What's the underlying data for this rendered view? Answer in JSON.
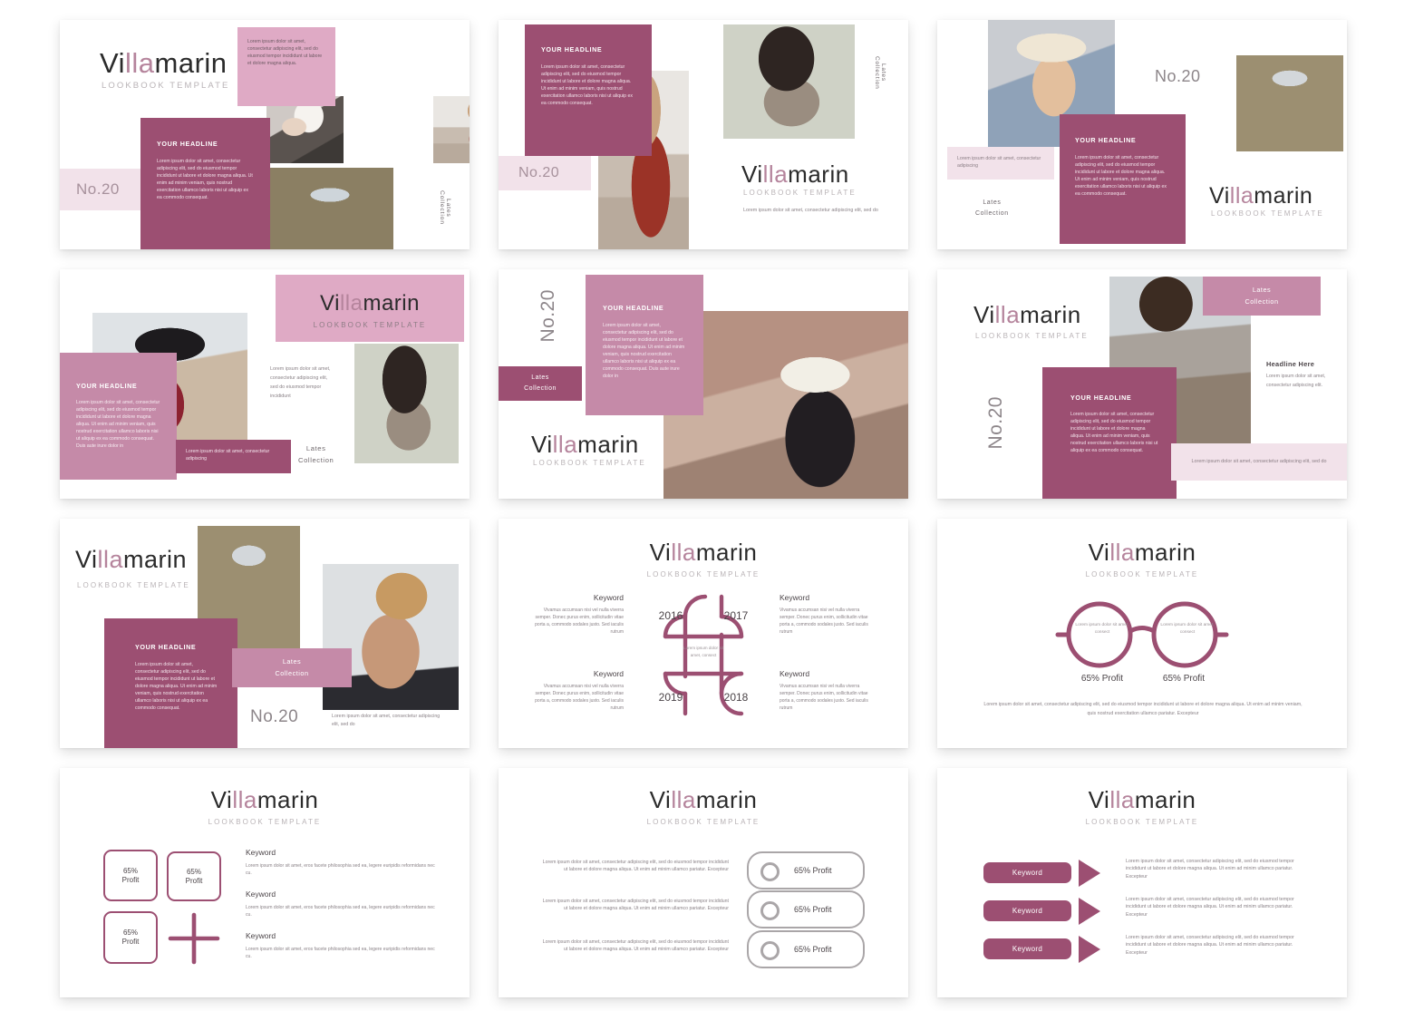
{
  "brand": {
    "name_part1": "Vi",
    "name_part2": "lla",
    "name_part3": "marin",
    "subtitle": "LOOKBOOK TEMPLATE",
    "number": "No.20",
    "collection_line1": "Lates",
    "collection_line2": "Collection",
    "collection": "Lates\nCollection",
    "headline": "YOUR HEADLINE",
    "headline_here": "Headline Here"
  },
  "colors": {
    "plum": "#9c4f72",
    "mid_mauve": "#c58aa8",
    "pink": "#dfaac5",
    "pale_pink": "#f2e2ea",
    "grey": "#aaa6a8",
    "text_dark": "#2b2b2b",
    "text_muted": "#8a8287"
  },
  "lorem": {
    "long": "Lorem ipsum dolor sit amet, consectetur adipiscing elit, sed do eiusmod tempor incididunt ut labore et dolore magna aliqua. Ut enim ad minim veniam, quis nostrud exercitation ullamco laboris nisi ut aliquip ex ea commodo consequat.",
    "long_extra": "Lorem ipsum dolor sit amet, consectetur adipiscing elit, sed do eiusmod tempor incididunt ut labore et dolore magna aliqua. Ut enim ad minim veniam, quis nostrud exercitation ullamco laboris nisi ut aliquip ex ea commodo consequat. Duis aute irure dolor in",
    "medium": "Lorem ipsum dolor sit amet, consectetur adipiscing elit, sed do eiusmod tempor incididunt ut labore et dolore magna aliqua.",
    "short": "Lorem ipsum dolor sit amet, consectetur adipiscing elit, sed do eiusmod tempor incididunt",
    "xshort": "Lorem ipsum dolor sit amet, consectetur adipiscing",
    "tiny": "Lorem ipsum dolor sit amet, consectetur adipiscing elit, sed do",
    "micro": "Lorem ipsum dolor sit amet, consectetur adipiscing elit.",
    "nano": "Lorem ipsum dolor sit amet, consect",
    "panel_block": "Lorem ipsum dolor sit amet, consectetur adipiscing elit, sed do eiusmod tempor incididunt ut labore et dolore magna aliqua. Ut enim ad minim ullamco pariatur. Excepteur",
    "footer_glasses": "Lorem ipsum dolor sit amet, consectetur adipiscing elit, sed do eiusmod tempor incididunt ut labore et dolore magna aliqua. Ut enim ad minim veniam, quis nostrud exercitation ullamco pariatur. Excepteur",
    "keyword_body": "Vivamus accumsan nisi vel nulla viverra semper. Donec purus enim, sollicitudin vitae porta a, commodo sodales justo. Sed iaculis rutrum",
    "square_body": "Lorem ipsum dolor sit amet, eros facete philosophia sed ea, legere euripidis reformidans nec cu."
  },
  "timeline": {
    "keyword": "Keyword",
    "years": [
      "2016",
      "2017",
      "2019",
      "2018"
    ],
    "center_text": "Lorem ipsum dolor sit amet, consect"
  },
  "glasses": {
    "lens_text": "Lorem ipsum dolor sit amet, consect",
    "profit_left": "65% Profit",
    "profit_right": "65% Profit"
  },
  "squares_slide": {
    "values": [
      "65%\nProfit",
      "65%\nProfit",
      "65%\nProfit"
    ],
    "keyword": "Keyword",
    "plus_icon": "plus-icon"
  },
  "pills_slide": {
    "labels": [
      "65% Profit",
      "65% Profit",
      "65% Profit"
    ]
  },
  "arrows_slide": {
    "labels": [
      "Keyword",
      "Keyword",
      "Keyword"
    ]
  }
}
